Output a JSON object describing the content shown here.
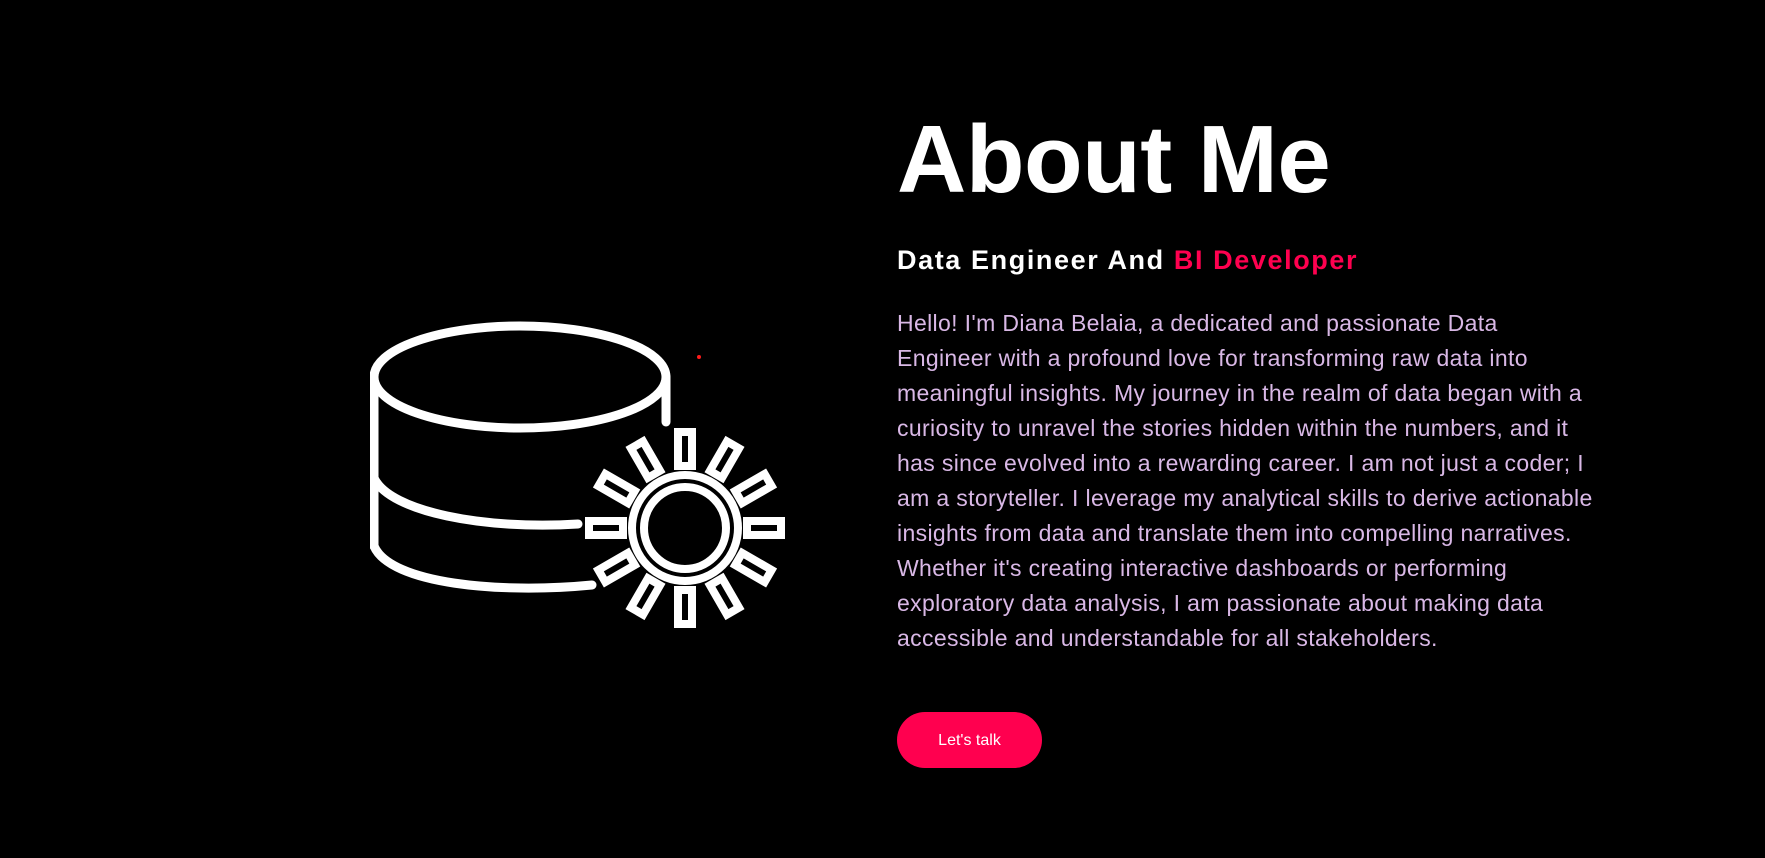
{
  "about": {
    "title": "About Me",
    "subtitle_plain": "Data Engineer And",
    "subtitle_accent": "BI Developer",
    "bio": "Hello! I'm Diana Belaia, a dedicated and passionate Data Engineer with a profound love for transforming raw data into meaningful insights. My journey in the realm of data began with a curiosity to unravel the stories hidden within the numbers, and it has since evolved into a rewarding career. I am not just a coder; I am a storyteller. I leverage my analytical skills to derive actionable insights from data and translate them into compelling narratives. Whether it's creating interactive dashboards or performing exploratory data analysis, I am passionate about making data accessible and understandable for all stakeholders.",
    "cta_label": "Let's talk"
  },
  "illustration": {
    "icon": "database-gear-icon"
  },
  "colors": {
    "background": "#000000",
    "accent": "#ff004f",
    "bio_text": "#d9b8e6",
    "heading": "#ffffff"
  }
}
